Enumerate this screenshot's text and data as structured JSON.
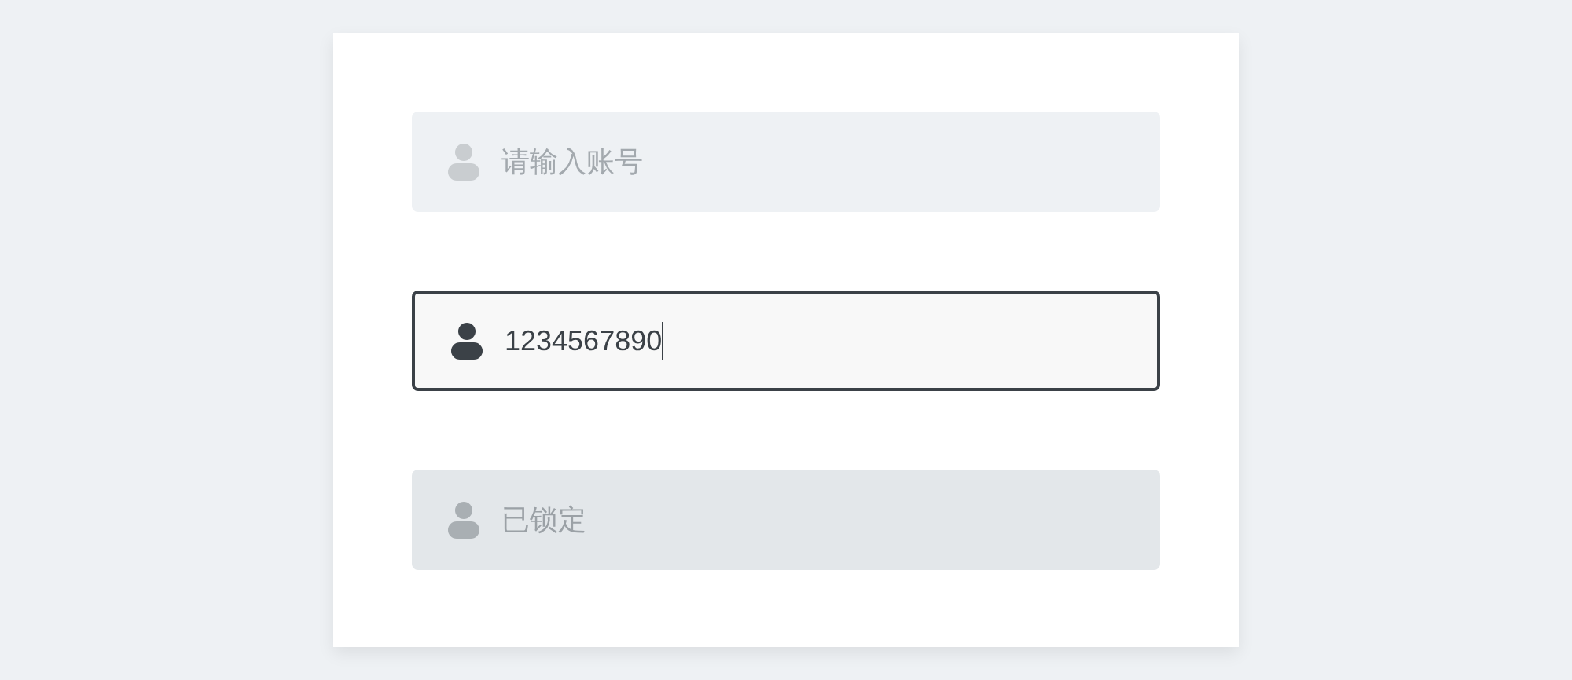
{
  "fields": [
    {
      "placeholder": "请输入账号",
      "focused": false,
      "disabled": false
    },
    {
      "value": "1234567890",
      "focused": true,
      "disabled": false
    },
    {
      "value": "已锁定",
      "focused": false,
      "disabled": true
    }
  ]
}
